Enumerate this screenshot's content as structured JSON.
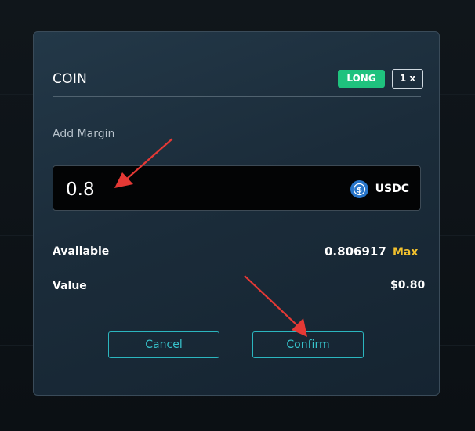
{
  "modal": {
    "title": "COIN",
    "side_badge": "LONG",
    "leverage_badge": "1 x",
    "field_label": "Add Margin",
    "amount_value": "0.8",
    "token_label": "USDC",
    "available_label": "Available",
    "available_value": "0.806917",
    "max_label": "Max",
    "value_label": "Value",
    "value_amount": "$0.80",
    "cancel_label": "Cancel",
    "confirm_label": "Confirm"
  },
  "colors": {
    "long_badge": "#1fc27e",
    "button_accent": "#37c3cc",
    "max_accent": "#f2c12e",
    "usdc_icon": "#2775ca",
    "annotation_arrow": "#e53935"
  },
  "icons": {
    "token_icon": "usdc-icon"
  }
}
